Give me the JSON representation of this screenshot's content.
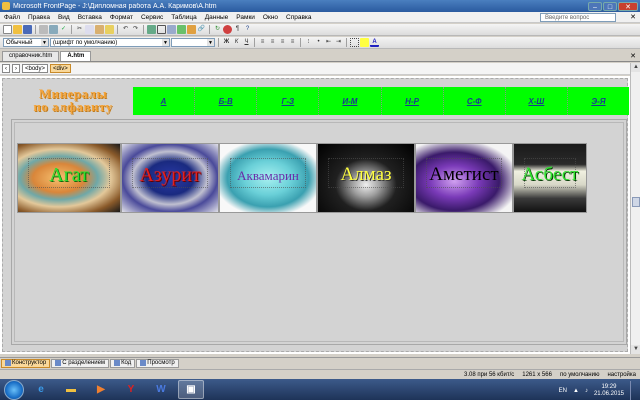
{
  "window": {
    "title": "Microsoft FrontPage - J:\\Дипломная работа А.А. Каримов\\A.htm"
  },
  "menu": {
    "items": [
      "Файл",
      "Правка",
      "Вид",
      "Вставка",
      "Формат",
      "Сервис",
      "Таблица",
      "Данные",
      "Рамки",
      "Окно",
      "Справка"
    ],
    "help_placeholder": "Введите вопрос"
  },
  "formatting": {
    "style": "Обычный",
    "font": "(шрифт по умолчанию)",
    "size": ""
  },
  "doc_tabs": [
    "справочник.htm",
    "A.htm"
  ],
  "tag_selector": [
    "<body>",
    "<div>"
  ],
  "page": {
    "logo_line1": "Минералы",
    "logo_line2": "по алфавиту",
    "nav": [
      "А",
      "Б-В",
      "Г-З",
      "И-М",
      "Н-Р",
      "С-Ф",
      "Х-Ш",
      "Э-Я"
    ],
    "minerals": [
      "Агат",
      "Азурит",
      "Аквамарин",
      "Алмаз",
      "Аметист",
      "Асбест"
    ]
  },
  "view_tabs": [
    "Конструктор",
    "С разделением",
    "Код",
    "Просмотр"
  ],
  "status": {
    "size": "3.08 при 56 кбит/с",
    "resolution": "1261 x 566",
    "mode": "по умолчанию",
    "custom": "настройка"
  },
  "taskbar": {
    "lang": "EN",
    "time": "19:29",
    "date": "21.06.2015"
  },
  "colors": {
    "nav_bg": "#00ff00",
    "logo": "#f4a43a",
    "titlebar": "#2a5a9f"
  }
}
